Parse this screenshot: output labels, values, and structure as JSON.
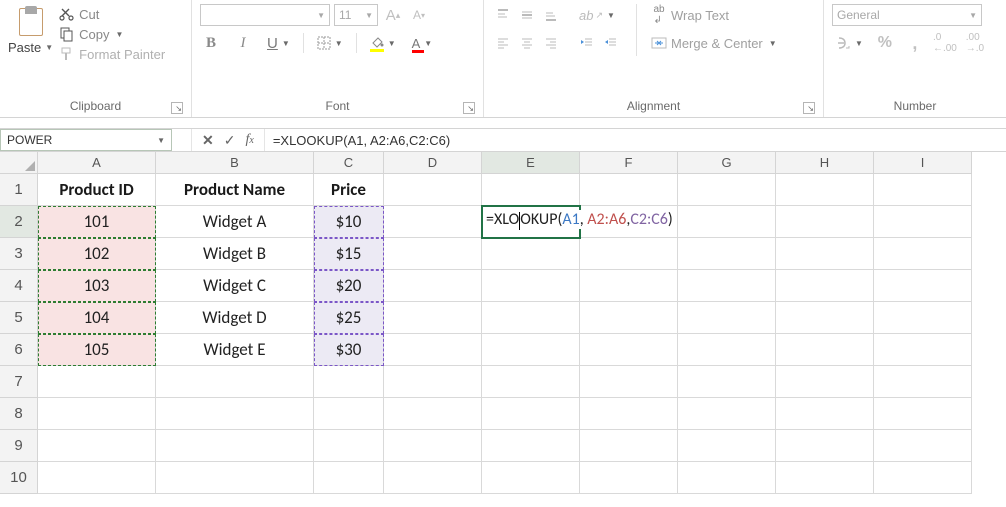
{
  "ribbon": {
    "clipboard": {
      "label": "Clipboard",
      "paste_label": "Paste",
      "cut_label": "Cut",
      "copy_label": "Copy",
      "format_painter_label": "Format Painter"
    },
    "font": {
      "label": "Font",
      "font_name": "",
      "font_size": "11",
      "bold": "B",
      "italic": "I",
      "underline": "U"
    },
    "alignment": {
      "label": "Alignment",
      "wrap_text_label": "Wrap Text",
      "merge_center_label": "Merge & Center"
    },
    "number": {
      "label": "Number",
      "format": "General"
    }
  },
  "name_box": "POWER",
  "formula_bar": "=XLOOKUP(A1, A2:A6,C2:C6)",
  "columns": [
    "A",
    "B",
    "C",
    "D",
    "E",
    "F",
    "G",
    "H",
    "I"
  ],
  "rows": [
    "1",
    "2",
    "3",
    "4",
    "5",
    "6",
    "7",
    "8",
    "9",
    "10"
  ],
  "headers": {
    "a": "Product ID",
    "b": "Product Name",
    "c": "Price"
  },
  "data": [
    {
      "id": "101",
      "name": "Widget A",
      "price": "$10"
    },
    {
      "id": "102",
      "name": "Widget B",
      "price": "$15"
    },
    {
      "id": "103",
      "name": "Widget C",
      "price": "$20"
    },
    {
      "id": "104",
      "name": "Widget D",
      "price": "$25"
    },
    {
      "id": "105",
      "name": "Widget E",
      "price": "$30"
    }
  ],
  "editing": {
    "prefix": "=XLO",
    "rest1": "OKUP(",
    "arg1": "A1",
    "sep1": ", ",
    "arg2": "A2:A6",
    "sep2": ",",
    "arg3": "C2:C6",
    "suffix": ")"
  }
}
